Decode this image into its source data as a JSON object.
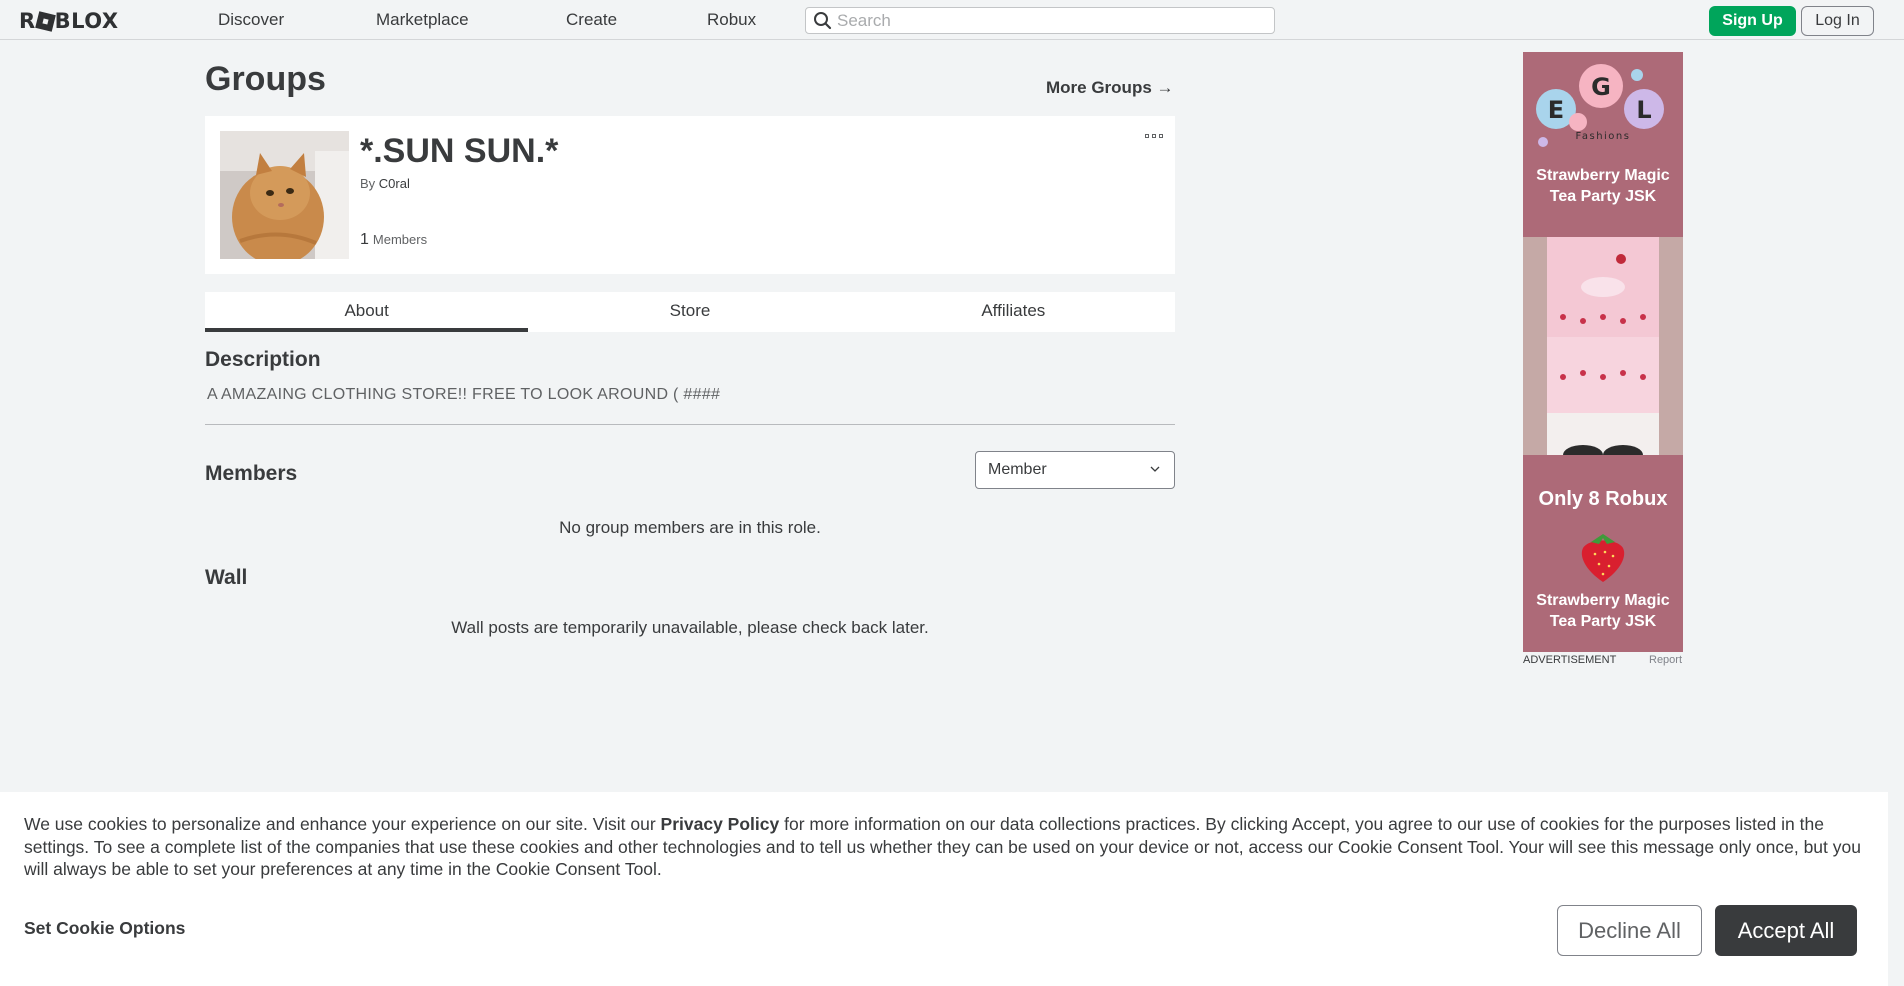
{
  "brand": {
    "logo_text": "ROBLOX"
  },
  "nav": {
    "links": [
      "Discover",
      "Marketplace",
      "Create",
      "Robux"
    ],
    "search_placeholder": "Search",
    "signup_label": "Sign Up",
    "login_label": "Log In"
  },
  "page": {
    "title": "Groups",
    "more_groups": "More Groups →"
  },
  "group": {
    "name": "*.SUN SUN.*",
    "by_prefix": "By",
    "owner": "C0ral",
    "member_count": "1",
    "members_label": "Members",
    "thumbnail_icon": "cat-photo"
  },
  "tabs": [
    "About",
    "Store",
    "Affiliates"
  ],
  "active_tab": "About",
  "about": {
    "description_heading": "Description",
    "description_text": "A AMAZAING CLOTHING STORE!! FREE TO LOOK AROUND ( ####",
    "members_heading": "Members",
    "role_selected": "Member",
    "members_empty": "No group members are in this role.",
    "wall_heading": "Wall",
    "wall_empty": "Wall posts are temporarily unavailable, please check back later."
  },
  "ad": {
    "brand_letters": [
      "E",
      "G",
      "L"
    ],
    "brand_sub": "Fashions",
    "line1": "Strawberry Magic Tea Party JSK",
    "price": "Only 8 Robux",
    "line2": "Strawberry Magic Tea Party JSK",
    "label": "ADVERTISEMENT",
    "report": "Report",
    "bg_color": "#ad6a78"
  },
  "cookie": {
    "text_before": "We use cookies to personalize and enhance your experience on our site. Visit our ",
    "privacy_link": "Privacy Policy",
    "text_after": " for more information on our data collections practices. By clicking Accept, you agree to our use of cookies for the purposes listed in the settings. To see a complete list of the companies that use these cookies and other technologies and to tell us whether they can be used on your device or not, access our Cookie Consent Tool. Your will see this message only once, but you will always be able to set your preferences at any time in the Cookie Consent Tool.",
    "options_label": "Set Cookie Options",
    "decline_label": "Decline All",
    "accept_label": "Accept All"
  },
  "colors": {
    "accent_green": "#00a55b",
    "text_dark": "#393b3d",
    "page_bg": "#f2f4f5"
  }
}
